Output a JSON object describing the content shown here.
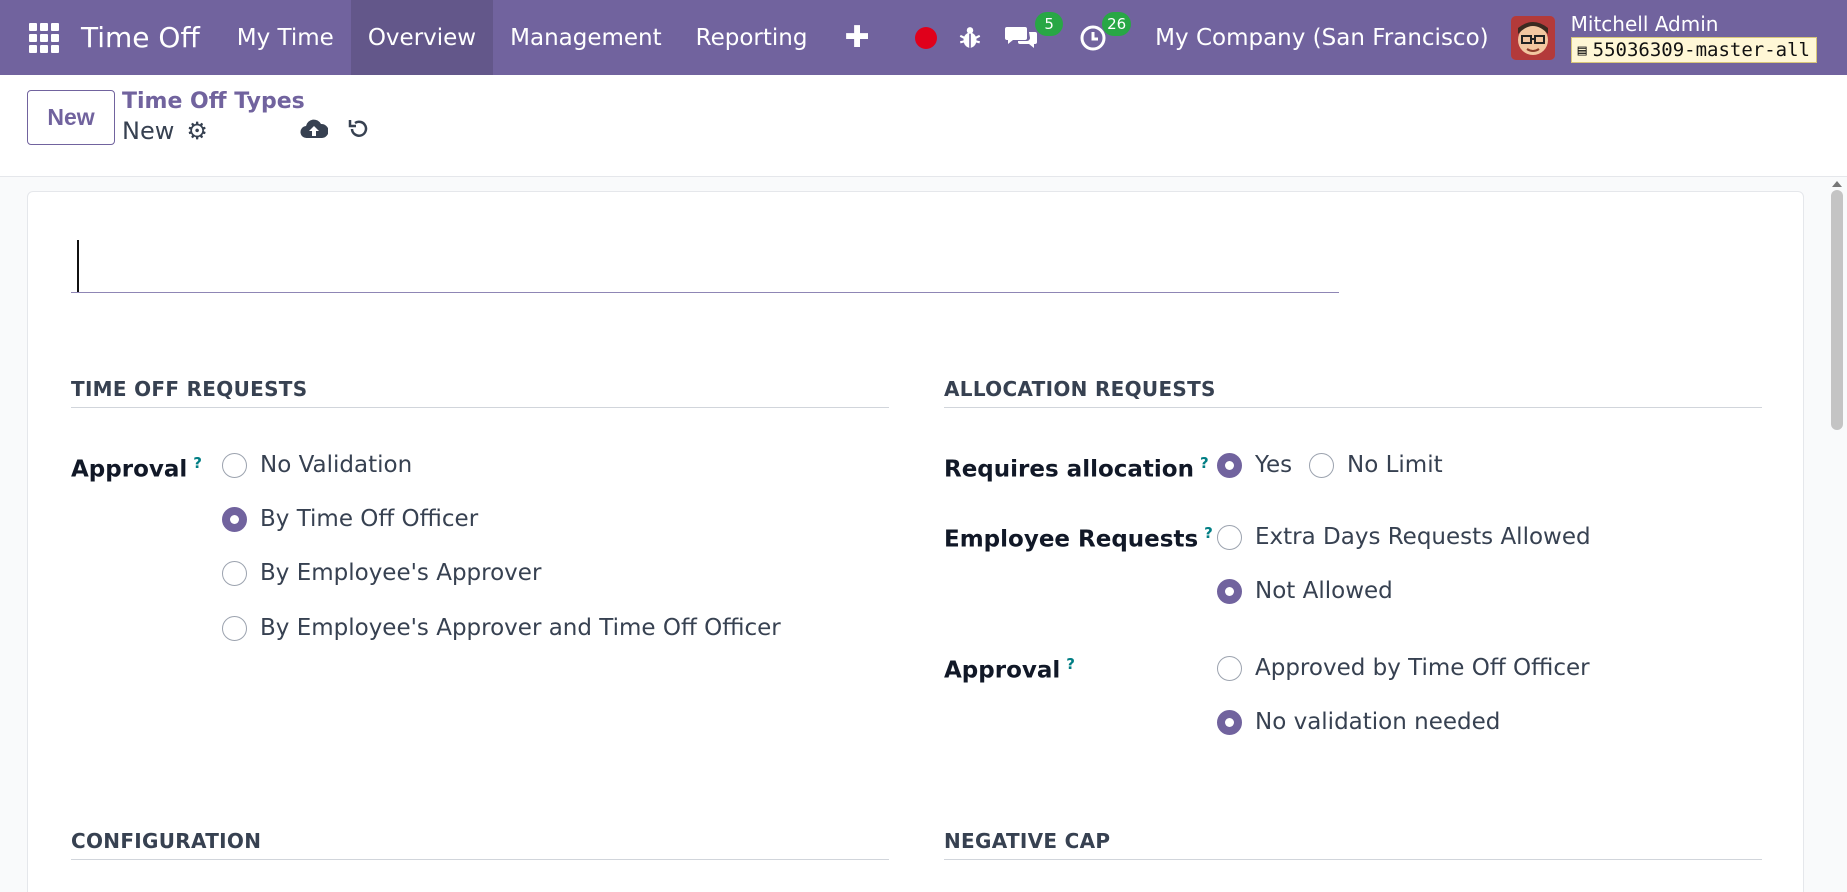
{
  "navbar": {
    "brand": "Time Off",
    "menu": [
      {
        "label": "My Time"
      },
      {
        "label": "Overview"
      },
      {
        "label": "Management"
      },
      {
        "label": "Reporting"
      }
    ],
    "messages_count": "5",
    "activities_count": "26",
    "company": "My Company (San Francisco)",
    "user_name": "Mitchell Admin",
    "db_name": "55036309-master-all"
  },
  "control_panel": {
    "new_label": "New",
    "breadcrumb_parent": "Time Off Types",
    "breadcrumb_current": "New"
  },
  "form": {
    "name_value": "",
    "time_off_requests": {
      "title": "TIME OFF REQUESTS",
      "approval_label": "Approval",
      "options": [
        {
          "label": "No Validation",
          "checked": false
        },
        {
          "label": "By Time Off Officer",
          "checked": true
        },
        {
          "label": "By Employee's Approver",
          "checked": false
        },
        {
          "label": "By Employee's Approver and Time Off Officer",
          "checked": false
        }
      ]
    },
    "allocation_requests": {
      "title": "ALLOCATION REQUESTS",
      "requires_allocation_label": "Requires allocation",
      "requires_allocation_options": [
        {
          "label": "Yes",
          "checked": true
        },
        {
          "label": "No Limit",
          "checked": false
        }
      ],
      "employee_requests_label": "Employee Requests",
      "employee_requests_options": [
        {
          "label": "Extra Days Requests Allowed",
          "checked": false
        },
        {
          "label": "Not Allowed",
          "checked": true
        }
      ],
      "approval_label": "Approval",
      "approval_options": [
        {
          "label": "Approved by Time Off Officer",
          "checked": false
        },
        {
          "label": "No validation needed",
          "checked": true
        }
      ]
    },
    "configuration_title": "CONFIGURATION",
    "negative_cap_title": "NEGATIVE CAP"
  },
  "colors": {
    "brand": "#71639e",
    "badge": "#28a745",
    "recording": "#e0001b",
    "help": "#017e84"
  }
}
